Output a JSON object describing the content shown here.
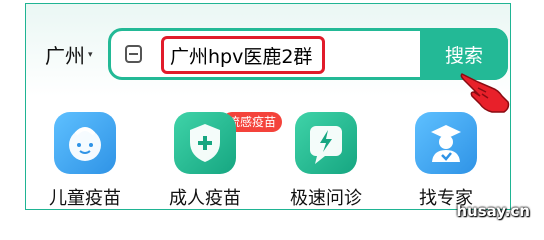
{
  "header": {
    "city": "广州",
    "city_caret": "▾"
  },
  "search": {
    "query": "广州hpv医鹿2群",
    "button_label": "搜索",
    "scan_icon": "scan-icon"
  },
  "badge": "流感疫苗",
  "quick_links": [
    {
      "label": "儿童疫苗",
      "icon": "child-face-icon",
      "color": "#3aa8f0"
    },
    {
      "label": "成人疫苗",
      "icon": "shield-plus-icon",
      "color": "#20b78f"
    },
    {
      "label": "极速问诊",
      "icon": "chat-lightning-icon",
      "color": "#20b78f"
    },
    {
      "label": "找专家",
      "icon": "doctor-icon",
      "color": "#3aa8f0"
    }
  ],
  "colors": {
    "accent": "#23b996",
    "highlight": "#e11b2a",
    "badge": "#f4433b"
  },
  "watermark": "husay.cn"
}
